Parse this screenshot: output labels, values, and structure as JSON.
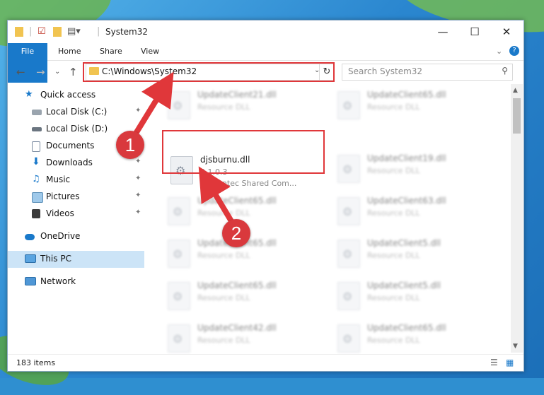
{
  "window": {
    "title": "System32",
    "controls": {
      "minimize": "—",
      "maximize": "☐",
      "close": "✕"
    }
  },
  "ribbon": {
    "tabs": [
      {
        "label": "File"
      },
      {
        "label": "Home"
      },
      {
        "label": "View",
        "note": ""
      },
      {
        "label": "Share"
      }
    ],
    "file": "File",
    "home": "Home",
    "share": "Share",
    "view": "View",
    "expand": "⌄",
    "help": "?"
  },
  "nav": {
    "back": "←",
    "forward": "→",
    "recent": "⌄",
    "up": "↑",
    "address": "C:\\Windows\\System32",
    "address_dropdown": "⌄",
    "refresh": "↻",
    "search_placeholder": "Search System32",
    "search_icon": "⚲"
  },
  "sidebar": {
    "items": [
      {
        "label": "Quick access",
        "icon": "star-icon",
        "pinned": false
      },
      {
        "label": "Local Disk (C:)",
        "icon": "drive-icon",
        "pinned": true
      },
      {
        "label": "Local Disk (D:)",
        "icon": "drive-icon",
        "pinned": true
      },
      {
        "label": "Documents",
        "icon": "documents-icon",
        "pinned": true
      },
      {
        "label": "Downloads",
        "icon": "download-icon",
        "pinned": true
      },
      {
        "label": "Music",
        "icon": "music-icon",
        "pinned": true
      },
      {
        "label": "Pictures",
        "icon": "pictures-icon",
        "pinned": true
      },
      {
        "label": "Videos",
        "icon": "video-icon",
        "pinned": true
      },
      {
        "label": "OneDrive",
        "icon": "cloud-icon",
        "pinned": false
      },
      {
        "label": "This PC",
        "icon": "pc-icon",
        "pinned": false
      },
      {
        "label": "Network",
        "icon": "network-icon",
        "pinned": false
      }
    ],
    "pin_glyph": "📌"
  },
  "files": {
    "left": [
      {
        "name": "UpdateClient21.dll",
        "type": "Resource DLL"
      },
      {
        "name": "djsburnu.dll",
        "version": "3.1.0.3",
        "company": "Symantec Shared Com..."
      },
      {
        "name": "UpdateClient65.dll",
        "type": "Resource DLL"
      },
      {
        "name": "UpdateClient65.dll",
        "type": "Resource DLL"
      },
      {
        "name": "UpdateClient65.dll",
        "type": "Resource DLL"
      },
      {
        "name": "UpdateClient42.dll",
        "type": "Resource DLL"
      }
    ],
    "right": [
      {
        "name": "UpdateClient65.dll",
        "type": "Resource DLL"
      },
      {
        "name": "UpdateClient19.dll",
        "type": "Resource DLL"
      },
      {
        "name": "UpdateClient63.dll",
        "type": "Resource DLL"
      },
      {
        "name": "UpdateClient5.dll",
        "type": "Resource DLL"
      },
      {
        "name": "UpdateClient5.dll",
        "type": "Resource DLL"
      },
      {
        "name": "UpdateClient65.dll",
        "type": "Resource DLL"
      }
    ]
  },
  "status": {
    "count": "183 items",
    "details_view": "☰",
    "tiles_view": "▦"
  },
  "annotations": {
    "badge1": "1",
    "badge2": "2",
    "color": "#e0373a"
  }
}
